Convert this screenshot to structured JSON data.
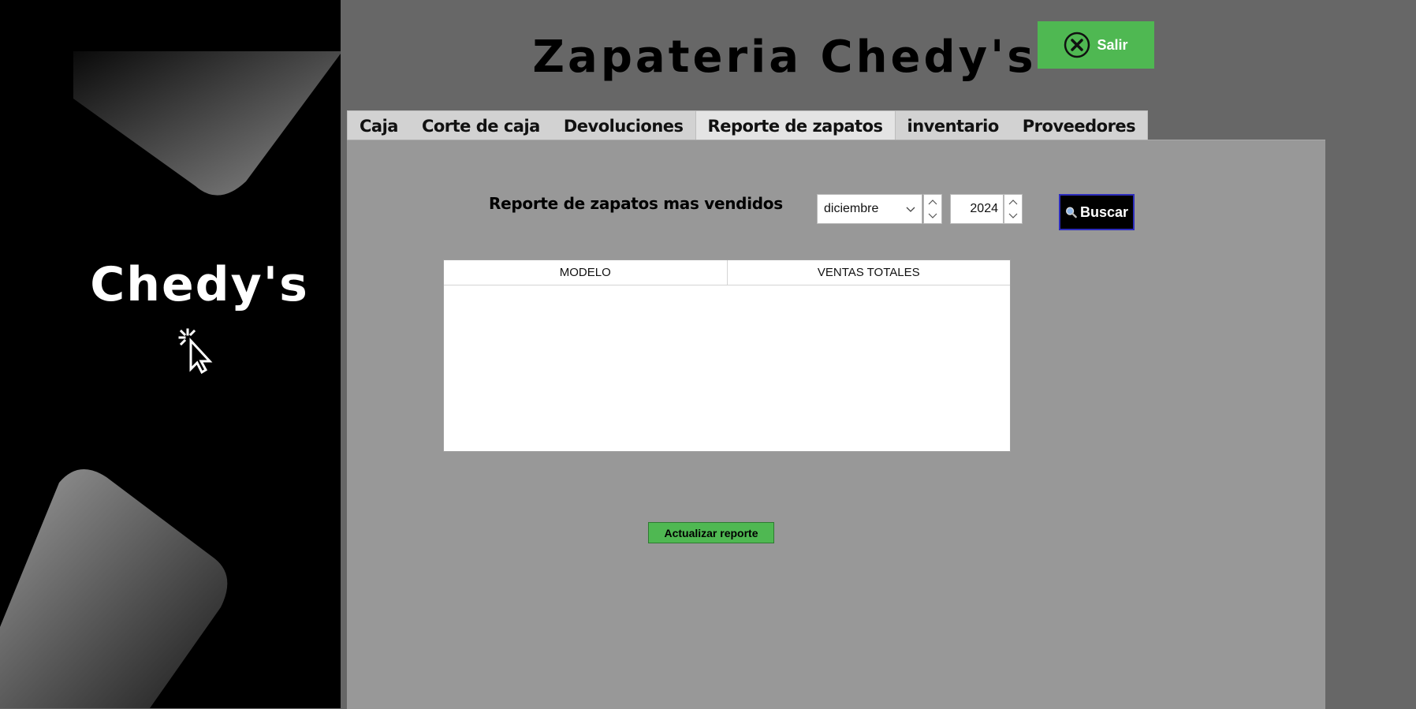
{
  "app": {
    "title": "Zapateria Chedy's"
  },
  "sidebar": {
    "brand": "Chedy's",
    "cursor_icon": "pointer-click-icon"
  },
  "header": {
    "exit_label": "Salir",
    "exit_icon": "close-circle-icon",
    "exit_color": "#4fb852"
  },
  "tabs": [
    {
      "label": "Caja",
      "active": false
    },
    {
      "label": "Corte de caja",
      "active": false
    },
    {
      "label": "Devoluciones",
      "active": false
    },
    {
      "label": "Reporte de zapatos",
      "active": true
    },
    {
      "label": "inventario",
      "active": false
    },
    {
      "label": "Proveedores",
      "active": false
    }
  ],
  "report": {
    "heading": "Reporte de zapatos mas vendidos",
    "month": "diciembre",
    "year": "2024",
    "search_label": "Buscar",
    "search_icon": "magnifier-icon",
    "columns": [
      "MODELO",
      "VENTAS TOTALES"
    ],
    "rows": [],
    "refresh_label": "Actualizar reporte"
  },
  "colors": {
    "background": "#676767",
    "panel": "#989898",
    "sidebar": "#000000",
    "accent_green": "#4fb852"
  }
}
